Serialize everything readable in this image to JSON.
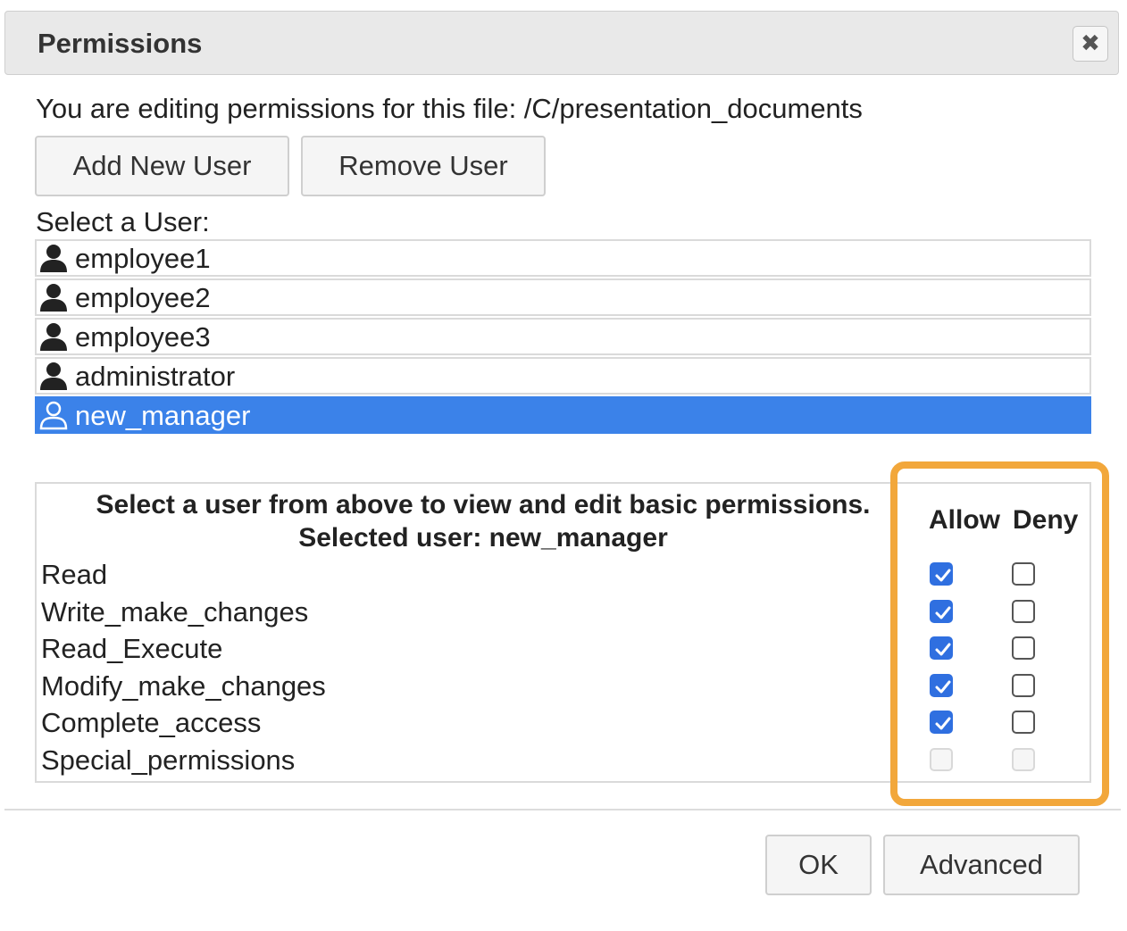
{
  "dialog": {
    "title": "Permissions",
    "close_label": "✖",
    "file_info": "You are editing permissions for this file: /C/presentation_documents"
  },
  "actions": {
    "add_user": "Add New User",
    "remove_user": "Remove User"
  },
  "users": {
    "label": "Select a User:",
    "items": [
      {
        "name": "employee1",
        "selected": false
      },
      {
        "name": "employee2",
        "selected": false
      },
      {
        "name": "employee3",
        "selected": false
      },
      {
        "name": "administrator",
        "selected": false
      },
      {
        "name": "new_manager",
        "selected": true
      }
    ]
  },
  "permissions": {
    "header_line1": "Select a user from above to view and edit basic permissions.",
    "header_line2": "Selected user: new_manager",
    "allow_label": "Allow",
    "deny_label": "Deny",
    "rows": [
      {
        "name": "Read",
        "allow": "checked",
        "deny": "unchecked"
      },
      {
        "name": "Write_make_changes",
        "allow": "checked",
        "deny": "unchecked"
      },
      {
        "name": "Read_Execute",
        "allow": "checked",
        "deny": "unchecked"
      },
      {
        "name": "Modify_make_changes",
        "allow": "checked",
        "deny": "unchecked"
      },
      {
        "name": "Complete_access",
        "allow": "checked",
        "deny": "unchecked"
      },
      {
        "name": "Special_permissions",
        "allow": "disabled",
        "deny": "disabled"
      }
    ]
  },
  "footer": {
    "ok": "OK",
    "advanced": "Advanced"
  },
  "colors": {
    "selected_row": "#3b82e9",
    "checkbox_checked": "#2f6fe0",
    "highlight": "#f2a73b"
  },
  "icons": {
    "user": "user-icon",
    "close": "close-icon",
    "check": "check-icon"
  }
}
